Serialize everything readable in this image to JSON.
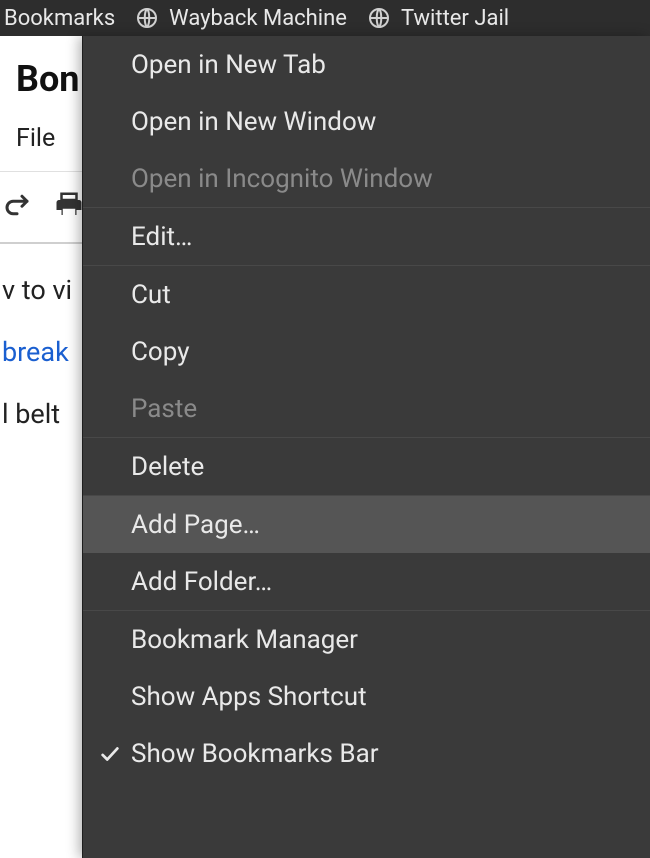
{
  "menubar": {
    "bookmarks_label": "Bookmarks",
    "items": [
      {
        "label": "Wayback Machine"
      },
      {
        "label": "Twitter Jail"
      }
    ]
  },
  "page": {
    "title_fragment": "Bon",
    "app_menu_file": "File",
    "body_lines": {
      "line1": "v to vi",
      "line2": "break",
      "line3": "l belt"
    }
  },
  "context_menu": {
    "items": [
      {
        "label": "Open in New Tab",
        "disabled": false,
        "hover": false,
        "checked": false
      },
      {
        "label": "Open in New Window",
        "disabled": false,
        "hover": false,
        "checked": false
      },
      {
        "label": "Open in Incognito Window",
        "disabled": true,
        "hover": false,
        "checked": false
      },
      "sep",
      {
        "label": "Edit…",
        "disabled": false,
        "hover": false,
        "checked": false
      },
      "sep",
      {
        "label": "Cut",
        "disabled": false,
        "hover": false,
        "checked": false
      },
      {
        "label": "Copy",
        "disabled": false,
        "hover": false,
        "checked": false
      },
      {
        "label": "Paste",
        "disabled": true,
        "hover": false,
        "checked": false
      },
      "sep",
      {
        "label": "Delete",
        "disabled": false,
        "hover": false,
        "checked": false
      },
      "sep",
      {
        "label": "Add Page…",
        "disabled": false,
        "hover": true,
        "checked": false
      },
      {
        "label": "Add Folder…",
        "disabled": false,
        "hover": false,
        "checked": false
      },
      "sep",
      {
        "label": "Bookmark Manager",
        "disabled": false,
        "hover": false,
        "checked": false
      },
      {
        "label": "Show Apps Shortcut",
        "disabled": false,
        "hover": false,
        "checked": false
      },
      {
        "label": "Show Bookmarks Bar",
        "disabled": false,
        "hover": false,
        "checked": true
      }
    ]
  }
}
